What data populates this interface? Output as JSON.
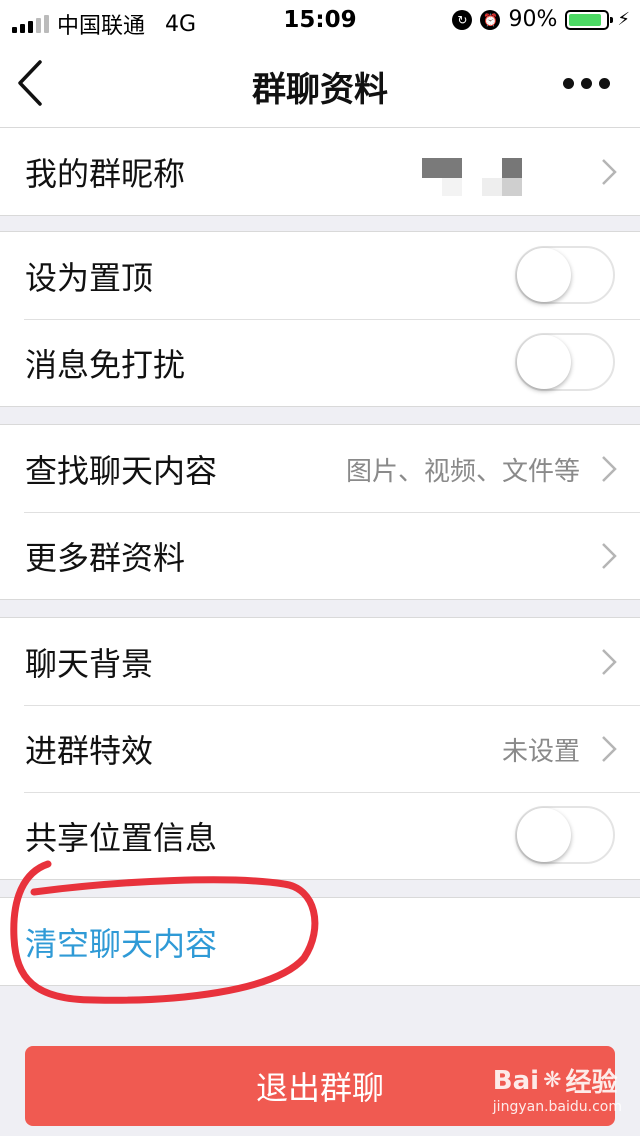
{
  "status_bar": {
    "carrier": "中国联通",
    "network": "4G",
    "time": "15:09",
    "battery": "90%",
    "battery_level": 0.9
  },
  "nav": {
    "title": "群聊资料",
    "back_icon": "chevron-left-icon",
    "more_icon": "more-dots-icon"
  },
  "rows": {
    "nickname": {
      "label": "我的群昵称"
    },
    "pin_top": {
      "label": "设为置顶",
      "on": false
    },
    "mute": {
      "label": "消息免打扰",
      "on": false
    },
    "search_history": {
      "label": "查找聊天内容",
      "value": "图片、视频、文件等"
    },
    "more_info": {
      "label": "更多群资料"
    },
    "background": {
      "label": "聊天背景"
    },
    "entry_effect": {
      "label": "进群特效",
      "value": "未设置"
    },
    "share_location": {
      "label": "共享位置信息",
      "on": false
    },
    "clear_history": {
      "label": "清空聊天内容"
    }
  },
  "exit_button": {
    "label": "退出群聊"
  },
  "watermark": {
    "brand": "Bai",
    "brand2": "经验",
    "url": "jingyan.baidu.com"
  },
  "colors": {
    "accent_blue": "#2f9ad6",
    "danger_red": "#f05a51",
    "annotation_red": "#e8323c",
    "battery_green": "#4cd964"
  }
}
